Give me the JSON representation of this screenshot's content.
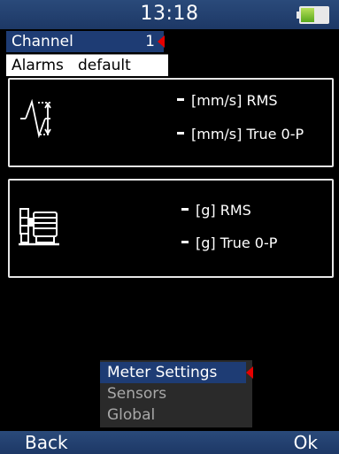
{
  "status": {
    "time": "13:18",
    "battery_level": 0.5
  },
  "context": {
    "channel_label": "Channel",
    "channel_value": "1",
    "alarms_label": "Alarms",
    "alarms_value": "default"
  },
  "velocity": {
    "icon": "velocity-waveform-icon",
    "rms": "[mm/s] RMS",
    "true0p": "[mm/s] True 0-P"
  },
  "acceleration": {
    "icon": "machine-bearing-icon",
    "rms": "[g] RMS",
    "true0p": "[g] True 0-P"
  },
  "menu": {
    "items": [
      {
        "label": "Meter Settings"
      },
      {
        "label": "Sensors"
      },
      {
        "label": "Global"
      }
    ]
  },
  "softkeys": {
    "left": "Back",
    "right": "Ok"
  },
  "colors": {
    "accent": "#1e3c74",
    "selection": "#e60000",
    "bar": "#1d3866"
  }
}
